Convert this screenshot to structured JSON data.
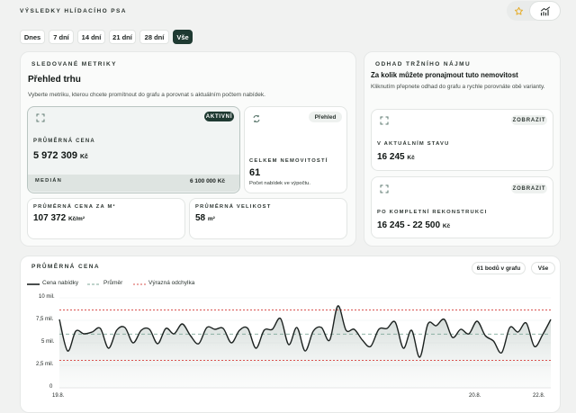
{
  "page_title": "VÝSLEDKY HLÍDACÍHO PSA",
  "top_icons": {
    "star": "star-icon",
    "chart": "chart-trend-icon"
  },
  "ranges": [
    {
      "label": "Dnes",
      "active": false
    },
    {
      "label": "7 dní",
      "active": false
    },
    {
      "label": "14 dní",
      "active": false
    },
    {
      "label": "21 dní",
      "active": false
    },
    {
      "label": "28 dní",
      "active": false
    },
    {
      "label": "Vše",
      "active": true
    }
  ],
  "metrics": {
    "eyebrow": "SLEDOVANÉ METRIKY",
    "title": "Přehled trhu",
    "description": "Vyberte metriku, kterou chcete promítnout do grafu a porovnat s aktuálním počtem nabídek.",
    "price": {
      "badge": "AKTIVNÍ",
      "label": "PRŮMĚRNÁ CENA",
      "value": "5 972 309",
      "unit": "Kč",
      "median_label": "MEDIÁN",
      "median_value": "6 100 000 Kč"
    },
    "total": {
      "badge": "Přehled",
      "label": "CELKEM NEMOVITOSTÍ",
      "value": "61",
      "note": "Počet nabídek ve výpočtu."
    },
    "per_m2": {
      "label": "PRŮMĚRNÁ CENA ZA M²",
      "value": "107 372",
      "unit": "Kč/m²"
    },
    "size": {
      "label": "PRŮMĚRNÁ VELIKOST",
      "value": "58",
      "unit": "m²"
    }
  },
  "rent": {
    "eyebrow": "ODHAD TRŽNÍHO NÁJMU",
    "title": "Za kolik můžete pronajmout tuto nemovitost",
    "description": "Kliknutím přepnete odhad do grafu a rychle porovnáte obě varianty.",
    "current": {
      "badge": "ZOBRAZIT",
      "label": "V AKTUÁLNÍM STAVU",
      "value": "16 245",
      "unit": "Kč"
    },
    "renovated": {
      "badge": "ZOBRAZIT",
      "label": "PO KOMPLETNÍ REKONSTRUKCI",
      "value": "16 245 - 22 500",
      "unit": "Kč"
    }
  },
  "chart_section": {
    "eyebrow": "PRŮMĚRNÁ CENA",
    "points_badge": "61 bodů v grafu",
    "all_badge": "Vše"
  },
  "chart_data": {
    "type": "line",
    "legend": [
      "Cena nabídky",
      "Průměr",
      "Výrazná odchylka"
    ],
    "y_ticks": [
      "0",
      "2,5 mil.",
      "5 mil.",
      "7,5 mil.",
      "10 mil."
    ],
    "x_ticks": [
      "19.8.",
      "20.8.",
      "22.8."
    ],
    "ylim": [
      0,
      10000000
    ],
    "average": 5972309,
    "deviation_upper": 8650000,
    "deviation_lower": 3050000,
    "series": [
      {
        "name": "Cena nabídky",
        "values": [
          7600000,
          4100000,
          6300000,
          6000000,
          6200000,
          6600000,
          4400000,
          6400000,
          6700000,
          5000000,
          6400000,
          6500000,
          4900000,
          6600000,
          6000000,
          7100000,
          5800000,
          4900000,
          6700000,
          6500000,
          6600000,
          5000000,
          6400000,
          6600000,
          4400000,
          6400000,
          6500000,
          7700000,
          4800000,
          6700000,
          4100000,
          6300000,
          6700000,
          5300000,
          9100000,
          6400000,
          6500000,
          5300000,
          4600000,
          6500000,
          6600000,
          7300000,
          4400000,
          6400000,
          3400000,
          7100000,
          6900000,
          7600000,
          5600000,
          6500000,
          6000000,
          7400000,
          5800000,
          5200000,
          3900000,
          6700000,
          6200000,
          7200000,
          4600000,
          5900000,
          7600000
        ]
      }
    ]
  }
}
